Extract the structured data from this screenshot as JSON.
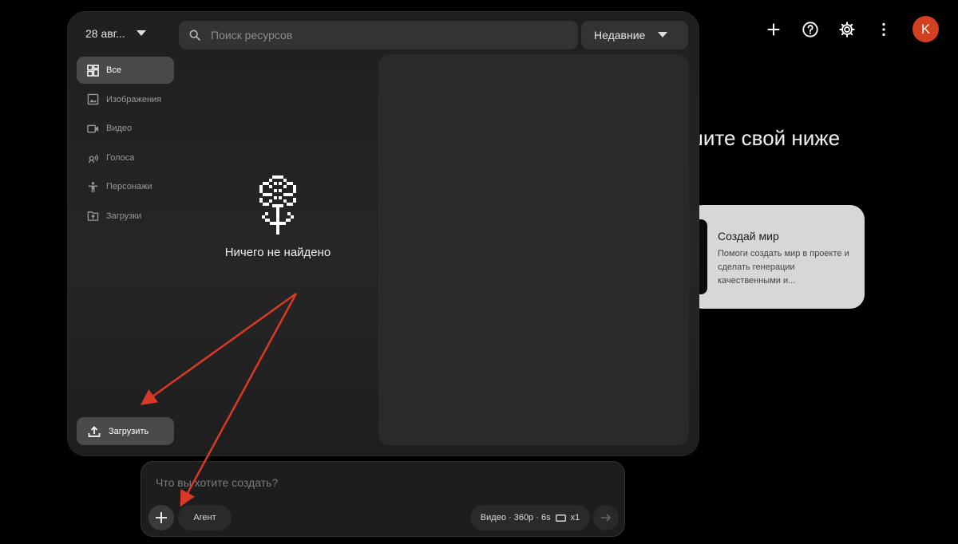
{
  "header": {
    "actions": [
      {
        "icon": "plus-icon"
      },
      {
        "icon": "help-icon"
      },
      {
        "icon": "gear-icon"
      },
      {
        "icon": "more-vert-icon"
      }
    ],
    "avatar_initial": "K",
    "avatar_color": "#d2401f"
  },
  "background": {
    "heading_fragment": "шите свой ниже",
    "card": {
      "title": "Создай мир",
      "description": "Помоги создать мир в проекте и сделать генерации качественными и..."
    }
  },
  "panel": {
    "date_filter": "28 авг...",
    "search_placeholder": "Поиск ресурсов",
    "sort": "Недавние",
    "sidebar": [
      {
        "label": "Все",
        "icon": "grid-icon",
        "active": true
      },
      {
        "label": "Изображения",
        "icon": "image-icon",
        "active": false
      },
      {
        "label": "Видео",
        "icon": "video-icon",
        "active": false
      },
      {
        "label": "Голоса",
        "icon": "voice-icon",
        "active": false
      },
      {
        "label": "Персонажи",
        "icon": "person-icon",
        "active": false
      },
      {
        "label": "Загрузки",
        "icon": "folder-upload-icon",
        "active": false
      }
    ],
    "empty_message": "Ничего не найдено",
    "upload_label": "Загрузить"
  },
  "composer": {
    "placeholder": "Что вы хотите создать?",
    "agent_label": "Агент",
    "settings": {
      "mode": "Видео",
      "resolution": "360p",
      "duration": "6s",
      "count": "x1",
      "display": "Видео · 360p · 6s"
    }
  },
  "annotations": {
    "arrow_color": "#d93a26"
  }
}
